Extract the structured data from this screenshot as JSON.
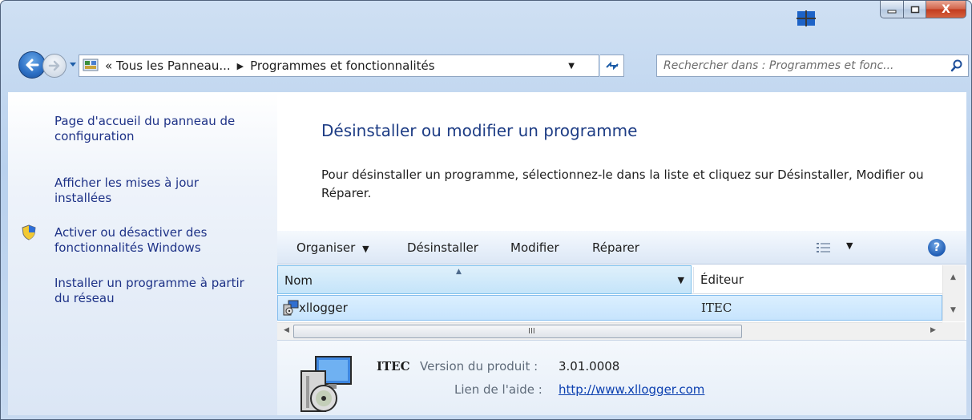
{
  "window": {
    "caption": {
      "minimize": "–",
      "maximize": "□",
      "close": "X"
    }
  },
  "nav": {
    "breadcrumb_prefix": "«",
    "breadcrumbs": [
      "Tous les Panneau...",
      "Programmes et fonctionnalités"
    ],
    "search_placeholder": "Rechercher dans : Programmes et fonc..."
  },
  "left_pane": {
    "tasks": [
      {
        "label_line1": "Page d'accueil du panneau de",
        "label_line2": "configuration"
      },
      {
        "label_line1": "Afficher les mises à jour",
        "label_line2": "installées"
      },
      {
        "label_line1": "Activer ou désactiver des",
        "label_line2": "fonctionnalités Windows",
        "icon": "uac-shield-icon"
      },
      {
        "label_line1": "Installer un programme à partir",
        "label_line2": "du réseau"
      }
    ]
  },
  "main": {
    "heading": "Désinstaller ou modifier un programme",
    "description": "Pour désinstaller un programme, sélectionnez-le dans la liste et cliquez sur Désinstaller, Modifier ou Réparer."
  },
  "toolbar": {
    "organize": "Organiser",
    "uninstall": "Désinstaller",
    "modify": "Modifier",
    "repair": "Réparer",
    "help": "?"
  },
  "list": {
    "columns": [
      "Nom",
      "Éditeur"
    ],
    "rows": [
      {
        "name": "xllogger",
        "publisher": "ITEC"
      }
    ],
    "hscroll_grip": "III"
  },
  "details": {
    "publisher": "ITEC",
    "version_label": "Version du produit :",
    "version_value": "3.01.0008",
    "help_label": "Lien de l'aide :",
    "help_link": "http://www.xllogger.com"
  },
  "colors": {
    "link_blue": "#1e3287",
    "heading_blue": "#1e3d85",
    "selection": "#c7e4fd",
    "close_red": "#c23b1e"
  }
}
